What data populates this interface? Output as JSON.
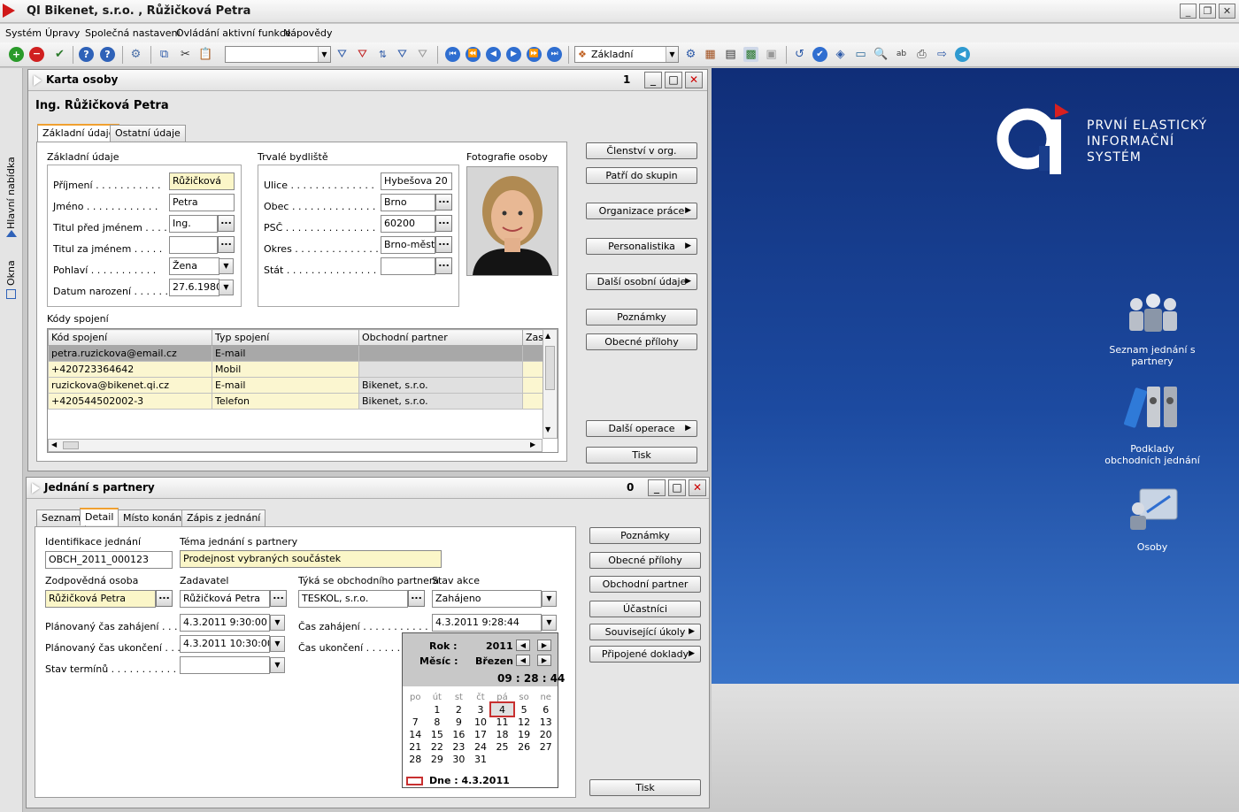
{
  "app": {
    "title": "QI  Bikenet, s.r.o. , Růžičková Petra"
  },
  "menu": [
    "Systém",
    "Úpravy",
    "Společná nastavení",
    "Ovládání aktivní funkce",
    "Nápovědy"
  ],
  "toolbar": {
    "combo1_value": "",
    "view_combo_value": "Základní"
  },
  "left_strip": {
    "main_menu": "Hlavní nabídka",
    "windows": "Okna"
  },
  "brand": {
    "line1": "PRVNÍ ELASTICKÝ",
    "line2": "INFORMAČNÍ",
    "line3": "SYSTÉM",
    "logo_text": "QI"
  },
  "desktop_icons": [
    {
      "label": "Seznam jednání s partnery",
      "icon": "people-icon"
    },
    {
      "label": "Podklady obchodních jednání",
      "icon": "binders-icon"
    },
    {
      "label": "Osoby",
      "icon": "persons-icon"
    }
  ],
  "karta": {
    "title": "Karta osoby",
    "count": "1",
    "person_name": "Ing. Růžičková Petra",
    "tabs": [
      "Základní údaje",
      "Ostatní údaje"
    ],
    "basic_group": "Základní údaje",
    "fields": {
      "prijmeni_label": "Příjmení . . . . . . . . . . .",
      "prijmeni": "Růžičková",
      "jmeno_label": "Jméno . . . . . . . . . . . .",
      "jmeno": "Petra",
      "titul_pred_label": "Titul před jménem . . . .",
      "titul_pred": "Ing.",
      "titul_za_label": "Titul za jménem . . . . .",
      "titul_za": "",
      "pohlavi_label": "Pohlaví . . . . . . . . . . .",
      "pohlavi": "Žena",
      "datum_label": "Datum narození . . . . . .",
      "datum": "27.6.1980"
    },
    "address_group": "Trvalé bydliště",
    "address": {
      "ulice_label": "Ulice . . . . . . . . . . . . . .",
      "ulice": "Hybešova 20",
      "obec_label": "Obec . . . . . . . . . . . . . .",
      "obec": "Brno",
      "psc_label": "PSČ . . . . . . . . . . . . . . .",
      "psc": "60200",
      "okres_label": "Okres . . . . . . . . . . . . . .",
      "okres": "Brno-město",
      "stat_label": "Stát . . . . . . . . . . . . . . .",
      "stat": ""
    },
    "photo_label": "Fotografie osoby",
    "contacts_label": "Kódy spojení",
    "contacts_columns": [
      "Kód spojení",
      "Typ spojení",
      "Obchodní partner",
      "Zas"
    ],
    "contacts_rows": [
      [
        "petra.ruzickova@email.cz",
        "E-mail",
        "",
        ""
      ],
      [
        "+420723364642",
        "Mobil",
        "",
        ""
      ],
      [
        "ruzickova@bikenet.qi.cz",
        "E-mail",
        "Bikenet, s.r.o.",
        ""
      ],
      [
        "+420544502002-3",
        "Telefon",
        "Bikenet, s.r.o.",
        ""
      ]
    ],
    "buttons": [
      "Členství v org.",
      "Patří do skupin",
      "Organizace práce",
      "Personalistika",
      "Další osobní údaje",
      "Poznámky",
      "Obecné přílohy",
      "Další operace",
      "Tisk"
    ]
  },
  "jednani": {
    "title": "Jednání s partnery",
    "count": "0",
    "tabs": [
      "Seznam",
      "Detail",
      "Místo konání",
      "Zápis z jednání"
    ],
    "identifikace_label": "Identifikace jednání",
    "identifikace": "OBCH_2011_000123",
    "tema_label": "Téma jednání s partnery",
    "tema": "Prodejnost vybraných součástek",
    "zodpovedna_label": "Zodpovědná osoba",
    "zodpovedna": "Růžičková Petra",
    "zadavatel_label": "Zadavatel",
    "zadavatel": "Růžičková Petra",
    "partner_label": "Týká se obchodního partnera",
    "partner": "TESKOL, s.r.o.",
    "stav_akce_label": "Stav akce",
    "stav_akce": "Zahájeno",
    "plan_zahajeni_label": "Plánovaný čas zahájení . . . .",
    "plan_zahajeni": "4.3.2011 9:30:00",
    "plan_ukonceni_label": "Plánovaný čas ukončení . . .",
    "plan_ukonceni": "4.3.2011 10:30:00",
    "stav_terminu_label": "Stav termínů . . . . . . . . . . .",
    "stav_terminu": "",
    "cas_zahajeni_label": "Čas zahájení . . . . . . . . . . . .",
    "cas_zahajeni": "4.3.2011 9:28:44",
    "cas_ukonceni_label": "Čas ukončení . . . . . . . . . . . .",
    "buttons": [
      "Poznámky",
      "Obecné přílohy",
      "Obchodní partner",
      "Účastníci",
      "Související úkoly",
      "Připojené doklady",
      "Tisk"
    ]
  },
  "calendar": {
    "year_label": "Rok :",
    "year": "2011",
    "month_label": "Měsíc :",
    "month": "Březen",
    "time": "09 : 28 : 44",
    "weekdays": [
      "po",
      "út",
      "st",
      "čt",
      "pá",
      "so",
      "ne"
    ],
    "weeks": [
      [
        "",
        "1",
        "2",
        "3",
        "4",
        "5",
        "6"
      ],
      [
        "7",
        "8",
        "9",
        "10",
        "11",
        "12",
        "13"
      ],
      [
        "14",
        "15",
        "16",
        "17",
        "18",
        "19",
        "20"
      ],
      [
        "21",
        "22",
        "23",
        "24",
        "25",
        "26",
        "27"
      ],
      [
        "28",
        "29",
        "30",
        "31",
        "",
        "",
        ""
      ]
    ],
    "selected": "4",
    "today_label": "Dne : 4.3.2011"
  }
}
